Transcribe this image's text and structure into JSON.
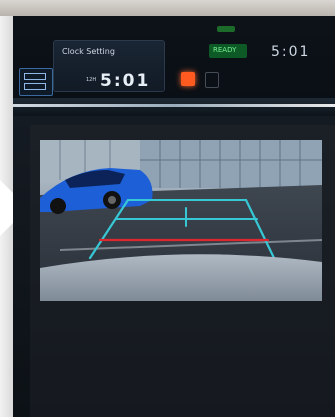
{
  "cluster": {
    "clock_setting_title": "Clock Setting",
    "clock_ampm": "12H",
    "clock_time": "5:01",
    "ready_label": "READY",
    "alt_time": "5:01"
  },
  "colors": {
    "ready_green": "#0d5a26",
    "warning_orange": "#ff5a1f",
    "guide_cyan": "#37c8d6",
    "guide_red": "#e0262e"
  },
  "camera": {
    "view": "rear-backup-camera",
    "guide_lines": [
      "distance-guide-near-red",
      "distance-guide-mid-cyan",
      "distance-guide-far-cyan",
      "center-guide-cyan"
    ]
  }
}
